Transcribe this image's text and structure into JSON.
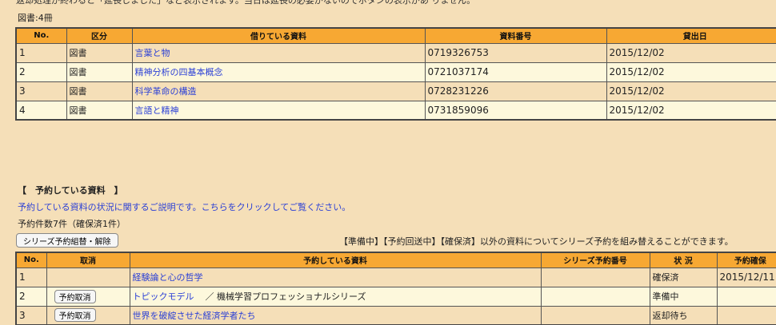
{
  "top_note": "返却処理が終わると「延長しました」など表示されます。当日は延長の必要がないのでボタンの表示があ りません。",
  "loans": {
    "count_label": "図書:4冊",
    "headers": [
      "No.",
      "区分",
      "借りている資料",
      "資料番号",
      "貸出日"
    ],
    "rows": [
      {
        "no": "1",
        "type": "図書",
        "title": "言葉と物",
        "id": "0719326753",
        "date": "2015/12/02"
      },
      {
        "no": "2",
        "type": "図書",
        "title": "精神分析の四基本概念",
        "id": "0721037174",
        "date": "2015/12/02"
      },
      {
        "no": "3",
        "type": "図書",
        "title": "科学革命の構造",
        "id": "0728231226",
        "date": "2015/12/02"
      },
      {
        "no": "4",
        "type": "図書",
        "title": "言語と精神",
        "id": "0731859096",
        "date": "2015/12/02"
      }
    ]
  },
  "reservations": {
    "section_title": "【　予約している資料　】",
    "help_link": "予約している資料の状況に関するご説明です。こちらをクリックしてご覧ください。",
    "count_label": "予約件数7件（確保済1件）",
    "series_button": "シリーズ予約組替・解除",
    "series_note": "【準備中】【予約回送中】【確保済】以外の資料についてシリーズ予約を組み替えることができます。",
    "headers": [
      "No.",
      "取消",
      "予約している資料",
      "シリーズ予約番号",
      "状 況",
      "予約確保"
    ],
    "cancel_label": "予約取消",
    "rows": [
      {
        "no": "1",
        "cancel": false,
        "title": "経験論と心の哲学",
        "series_suffix": "",
        "series_no": "",
        "status": "確保済",
        "date": "2015/12/11"
      },
      {
        "no": "2",
        "cancel": true,
        "title": "トピックモデル",
        "series_suffix": "／ 機械学習プロフェッショナルシリーズ",
        "series_no": "",
        "status": "準備中",
        "date": ""
      },
      {
        "no": "3",
        "cancel": true,
        "title": "世界を破綻させた経済学者たち",
        "series_suffix": "",
        "series_no": "",
        "status": "返却待ち",
        "date": ""
      }
    ]
  }
}
